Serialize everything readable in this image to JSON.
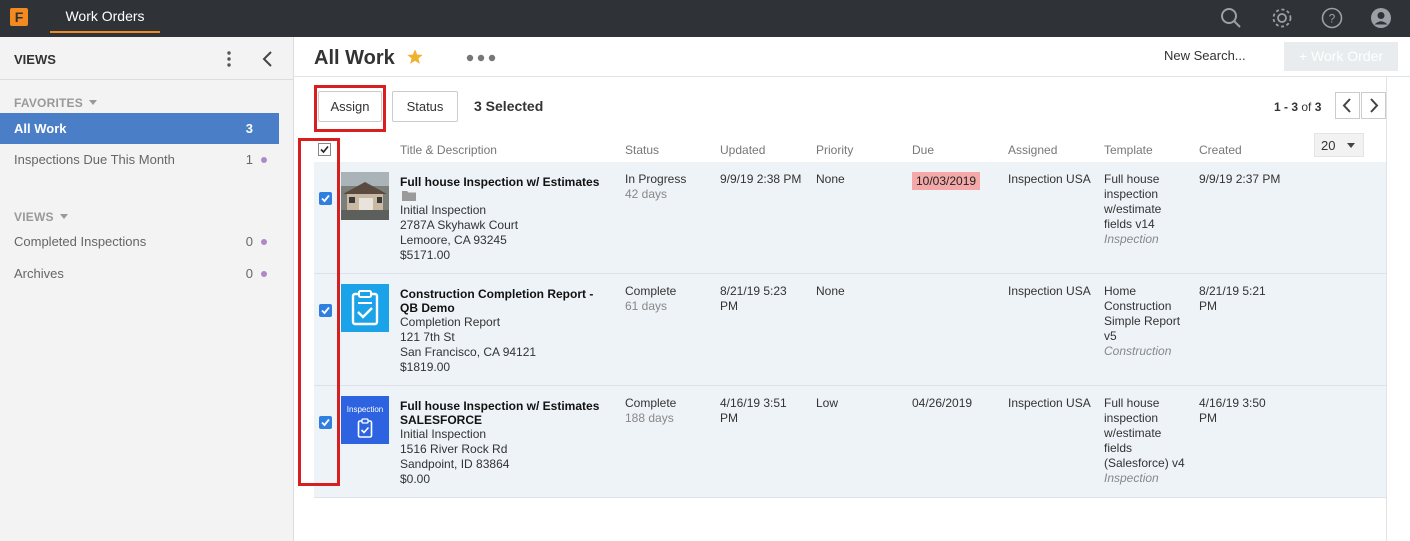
{
  "app": {
    "logo_letter": "F",
    "nav_tab": "Work Orders"
  },
  "sidebar": {
    "header": "VIEWS",
    "favorites_label": "FAVORITES",
    "favorites": [
      {
        "label": "All Work",
        "count": "3",
        "active": true
      },
      {
        "label": "Inspections Due This Month",
        "count": "1"
      }
    ],
    "views_label": "VIEWS",
    "views": [
      {
        "label": "Completed Inspections",
        "count": "0"
      },
      {
        "label": "Archives",
        "count": "0"
      }
    ]
  },
  "main": {
    "title": "All Work",
    "new_search": "New Search...",
    "new_work_order": "+ Work Order",
    "assign": "Assign",
    "status": "Status",
    "selected": "3 Selected",
    "pager": {
      "range": "1 - 3",
      "of": "of",
      "total": "3"
    },
    "per_page": "20"
  },
  "table": {
    "columns": [
      "Title & Description",
      "Status",
      "Updated",
      "Priority",
      "Due",
      "Assigned",
      "Template",
      "Created"
    ],
    "rows": [
      {
        "title": "Full house Inspection w/ Estimates",
        "subtitle": "Initial Inspection",
        "address1": "2787A Skyhawk Court",
        "address2": "Lemoore, CA 93245",
        "amount": "$5171.00",
        "status": "In Progress",
        "status_days": "42 days",
        "updated": "9/9/19 2:38 PM",
        "priority": "None",
        "due": "10/03/2019",
        "assigned": "Inspection USA",
        "template": [
          "Full house",
          "inspection",
          "w/estimate",
          "fields v14"
        ],
        "template_category": "Inspection",
        "created": "9/9/19 2:37 PM"
      },
      {
        "title": "Construction Completion Report -",
        "title2": "QB Demo",
        "subtitle": "Completion Report",
        "address1": "121 7th St",
        "address2": "San Francisco, CA 94121",
        "amount": "$1819.00",
        "status": "Complete",
        "status_days": "61 days",
        "updated": [
          "8/21/19 5:23",
          "PM"
        ],
        "priority": "None",
        "due": "",
        "assigned": "Inspection USA",
        "template": [
          "Home",
          "Construction",
          "Simple Report",
          "v5"
        ],
        "template_category": "Construction",
        "created": [
          "8/21/19 5:21",
          "PM"
        ]
      },
      {
        "title": "Full house Inspection w/ Estimates",
        "title2": "SALESFORCE",
        "thumb_label": "Inspection",
        "subtitle": "Initial Inspection",
        "address1": "1516 River Rock Rd",
        "address2": "Sandpoint, ID 83864",
        "amount": "$0.00",
        "status": "Complete",
        "status_days": "188 days",
        "updated": [
          "4/16/19 3:51",
          "PM"
        ],
        "priority": "Low",
        "due": "04/26/2019",
        "assigned": "Inspection USA",
        "template": [
          "Full house",
          "inspection",
          "w/estimate",
          "fields",
          "(Salesforce) v4"
        ],
        "template_category": "Inspection",
        "created": [
          "4/16/19 3:50",
          "PM"
        ]
      }
    ]
  },
  "colors": {
    "accent_orange": "#f28a1f",
    "active_blue": "#4a7fc7",
    "checkbox_blue": "#2f7fe0",
    "highlight_red": "#d81f1f",
    "due_badge": "#f4a8a8"
  }
}
